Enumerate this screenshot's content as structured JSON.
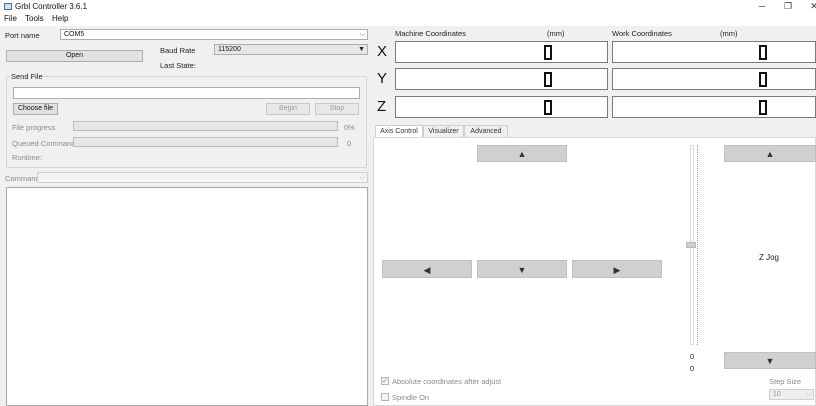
{
  "window": {
    "title": "Grbl Controller 3.6.1",
    "minimize_glyph": "─",
    "restore_glyph": "❐",
    "close_glyph": "✕"
  },
  "menu": {
    "items": [
      "File",
      "Tools",
      "Help"
    ]
  },
  "connection": {
    "port_label": "Port name",
    "port_value": "COM5",
    "open_label": "Open",
    "baud_label": "Baud Rate",
    "baud_value": "115200",
    "last_state_label": "Last State:"
  },
  "send_file": {
    "group_title": "Send File",
    "file_path": "",
    "choose_label": "Choose file",
    "begin_label": "Begin",
    "stop_label": "Stop",
    "progress_label": "File progress",
    "progress_value": "0%",
    "queued_label": "Queued Commands",
    "queued_value": "0",
    "runtime_label": "Runtime:"
  },
  "command": {
    "label": "Command",
    "value": ""
  },
  "coordinates": {
    "machine_label": "Machine Coordinates",
    "work_label": "Work Coordinates",
    "unit": "(mm)",
    "axes": [
      {
        "letter": "X",
        "machine": "0",
        "work": "0"
      },
      {
        "letter": "Y",
        "machine": "0",
        "work": "0"
      },
      {
        "letter": "Z",
        "machine": "0",
        "work": "0"
      }
    ]
  },
  "tabs": [
    "Axis Control",
    "Visualizer",
    "Advanced"
  ],
  "axis_control": {
    "up_glyph": "▲",
    "down_glyph": "▼",
    "left_glyph": "◀",
    "right_glyph": "▶",
    "z_jog_label": "Z Jog",
    "slider_min": "0",
    "slider_value": "0",
    "absolute_label": "Absolute coordinates after adjust",
    "absolute_checked": true,
    "spindle_label": "Spindle On",
    "spindle_checked": false,
    "step_size_label": "Step Size",
    "step_size_value": "10"
  },
  "icons": {
    "app": "app-icon",
    "dropdown": "chevron-down-icon"
  }
}
